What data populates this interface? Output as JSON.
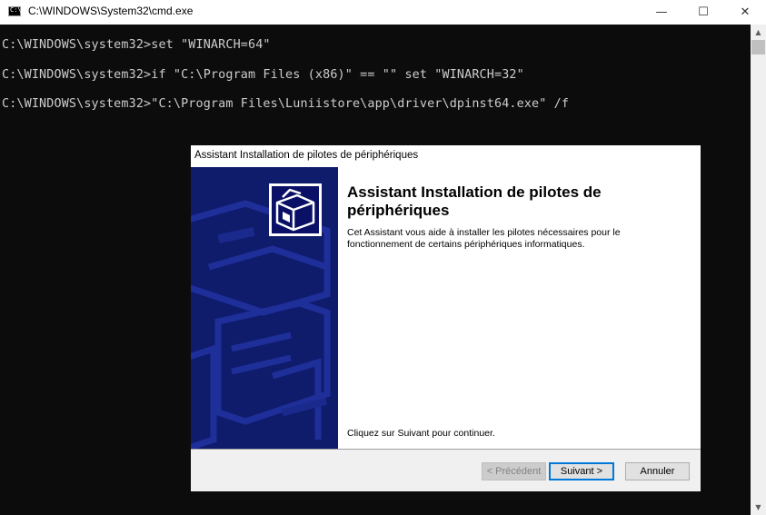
{
  "window": {
    "title": "C:\\WINDOWS\\System32\\cmd.exe",
    "min_glyph": "—",
    "max_glyph": "☐",
    "close_glyph": "✕"
  },
  "console": {
    "lines": [
      "C:\\WINDOWS\\system32>set \"WINARCH=64\"",
      "C:\\WINDOWS\\system32>if \"C:\\Program Files (x86)\" == \"\" set \"WINARCH=32\"",
      "C:\\WINDOWS\\system32>\"C:\\Program Files\\Luniistore\\app\\driver\\dpinst64.exe\" /f"
    ],
    "scroll_up_glyph": "▲",
    "scroll_down_glyph": "▼"
  },
  "dialog": {
    "title": "Assistant Installation de pilotes de périphériques",
    "heading": "Assistant Installation de pilotes de périphériques",
    "description": "Cet Assistant vous aide à installer les pilotes nécessaires pour le fonctionnement de certains périphériques informatiques.",
    "hint": "Cliquez sur Suivant pour continuer.",
    "buttons": {
      "prev": "< Précédent",
      "next": "Suivant >",
      "cancel": "Annuler"
    }
  },
  "colors": {
    "console_bg": "#0c0c0c",
    "console_text": "#cccccc",
    "sidebar_blue": "#0f1b6b",
    "accent": "#0078d7"
  },
  "icons": {
    "app": "cmd-icon",
    "wizard": "driver-box-icon"
  }
}
